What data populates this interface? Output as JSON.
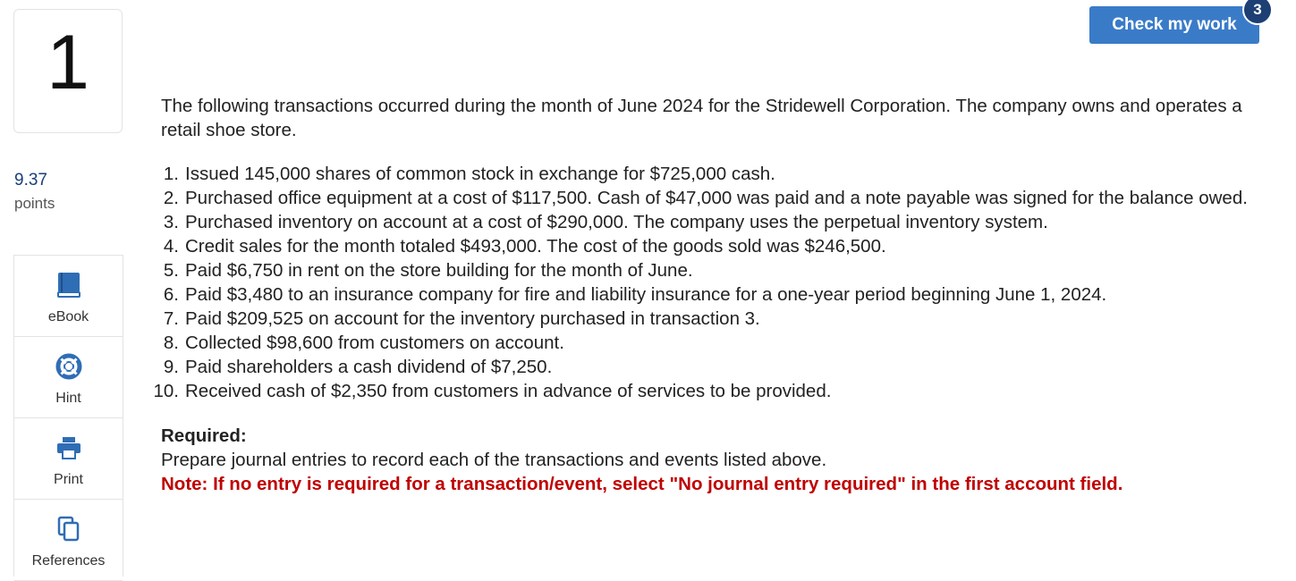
{
  "question": {
    "number": "1",
    "points_value": "9.37",
    "points_label": "points"
  },
  "toolbar": {
    "check_label": "Check my work",
    "check_badge": "3"
  },
  "tools": [
    {
      "label": "eBook",
      "icon": "book-icon"
    },
    {
      "label": "Hint",
      "icon": "lifebuoy-icon"
    },
    {
      "label": "Print",
      "icon": "printer-icon"
    },
    {
      "label": "References",
      "icon": "copy-icon"
    }
  ],
  "body": {
    "intro": "The following transactions occurred during the month of June 2024 for the Stridewell Corporation. The company owns and operates a retail shoe store.",
    "transactions": [
      {
        "n": "1.",
        "text": "Issued 145,000 shares of common stock in exchange for $725,000 cash."
      },
      {
        "n": "2.",
        "text": "Purchased office equipment at a cost of $117,500. Cash of $47,000 was paid and a note payable was signed for the balance owed."
      },
      {
        "n": "3.",
        "text": "Purchased inventory on account at a cost of $290,000. The company uses the perpetual inventory system."
      },
      {
        "n": "4.",
        "text": "Credit sales for the month totaled $493,000. The cost of the goods sold was $246,500."
      },
      {
        "n": "5.",
        "text": "Paid $6,750 in rent on the store building for the month of June."
      },
      {
        "n": "6.",
        "text": "Paid $3,480 to an insurance company for fire and liability insurance for a one-year period beginning June 1, 2024."
      },
      {
        "n": "7.",
        "text": "Paid $209,525 on account for the inventory purchased in transaction 3."
      },
      {
        "n": "8.",
        "text": "Collected $98,600 from customers on account."
      },
      {
        "n": "9.",
        "text": "Paid shareholders a cash dividend of $7,250."
      },
      {
        "n": "10.",
        "text": "Received cash of $2,350 from customers in advance of services to be provided."
      }
    ],
    "required_heading": "Required:",
    "required_text": "Prepare journal entries to record each of the transactions and events listed above.",
    "note": "Note: If no entry is required for a transaction/event, select \"No journal entry required\" in the first account field."
  },
  "colors": {
    "accent": "#3a7bc8",
    "badge": "#1d3f73",
    "note": "#c00000",
    "icon": "#2f6db5"
  }
}
